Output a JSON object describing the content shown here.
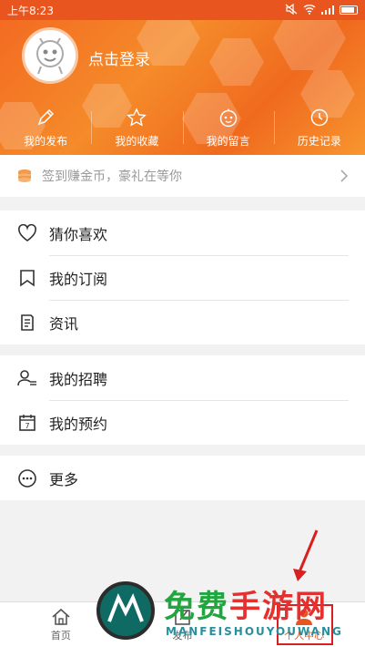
{
  "status_bar": {
    "time": "上午8:23"
  },
  "header": {
    "login_text": "点击登录",
    "nav": [
      {
        "label": "我的发布",
        "icon": "pencil-icon"
      },
      {
        "label": "我的收藏",
        "icon": "star-icon"
      },
      {
        "label": "我的留言",
        "icon": "face-icon"
      },
      {
        "label": "历史记录",
        "icon": "clock-icon"
      }
    ]
  },
  "checkin": {
    "text": "签到赚金币，豪礼在等你",
    "icon": "coins-icon"
  },
  "menu_group_1": [
    {
      "label": "猜你喜欢",
      "icon": "heart-icon"
    },
    {
      "label": "我的订阅",
      "icon": "bookmark-icon"
    },
    {
      "label": "资讯",
      "icon": "news-icon"
    }
  ],
  "menu_group_2": [
    {
      "label": "我的招聘",
      "icon": "person-list-icon"
    },
    {
      "label": "我的预约",
      "icon": "calendar-icon"
    }
  ],
  "menu_group_3": [
    {
      "label": "更多",
      "icon": "more-icon"
    }
  ],
  "bottom_nav": [
    {
      "label": "首页",
      "icon": "home-icon"
    },
    {
      "label": "发布",
      "icon": "edit-icon"
    },
    {
      "label": "个人中心",
      "icon": "user-icon",
      "active": true
    }
  ],
  "watermark": {
    "title_green": "免费",
    "title_red": "手游网",
    "subtitle": "MANFEISHOUYOUWANG"
  },
  "colors": {
    "accent": "#e8551e",
    "annotation": "#d82020"
  }
}
